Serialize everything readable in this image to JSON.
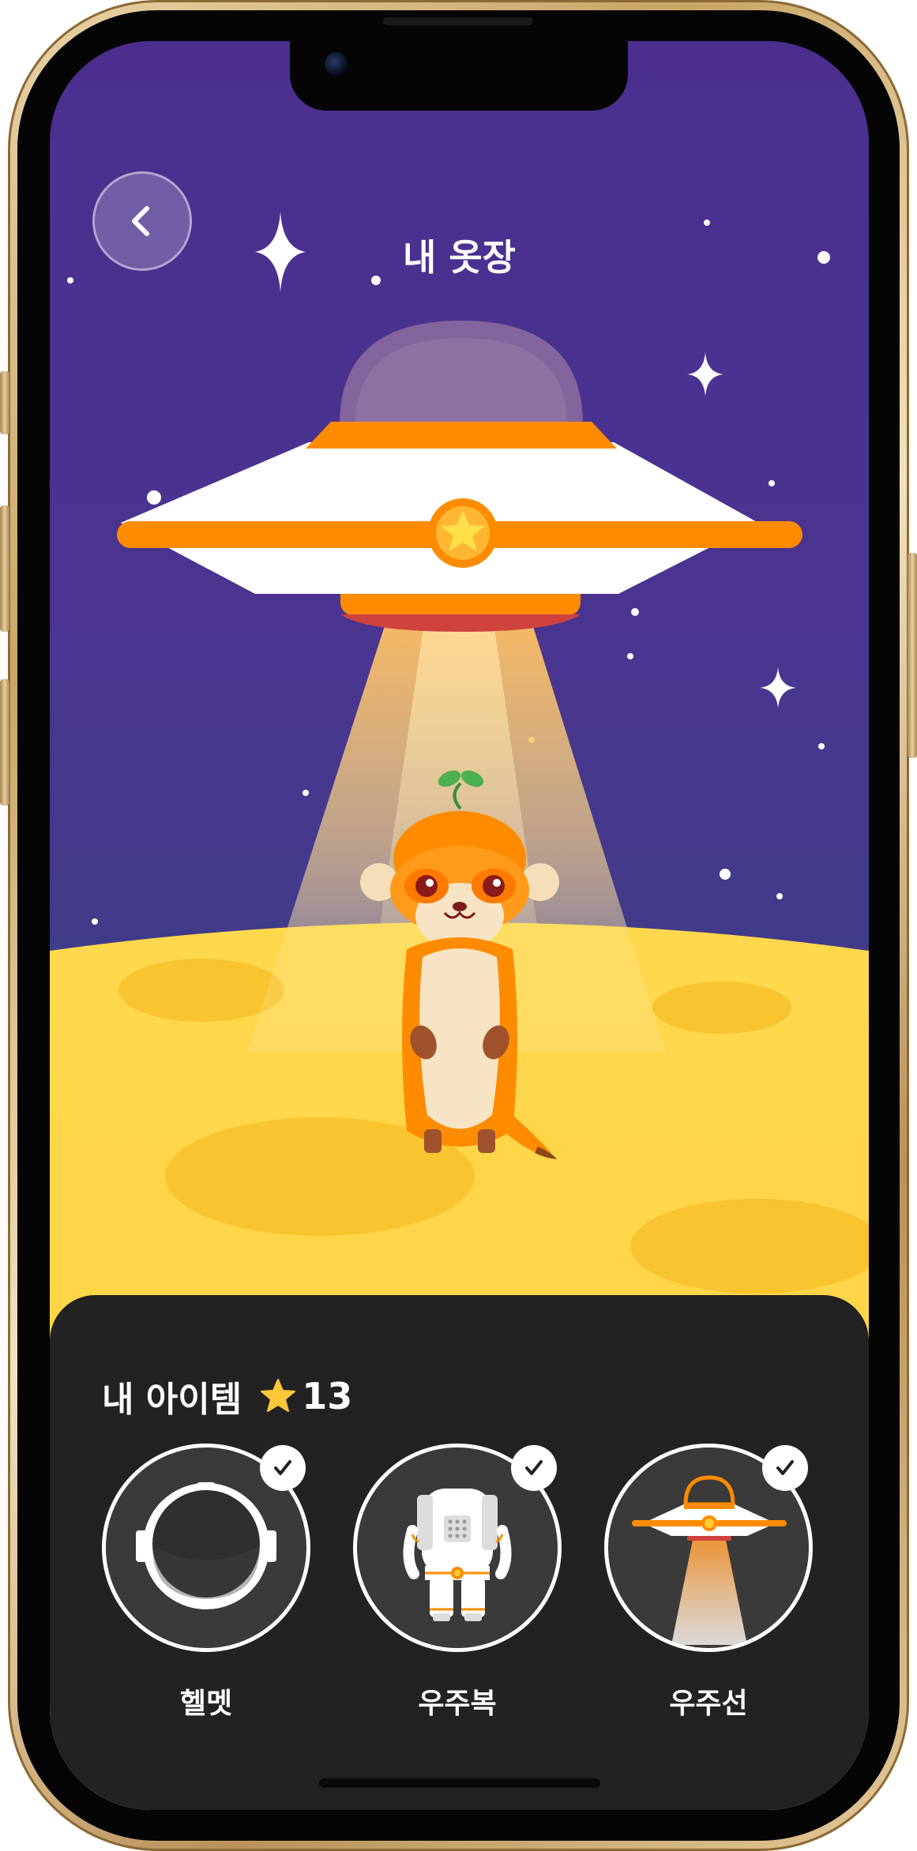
{
  "header": {
    "title": "내 옷장",
    "back_icon": "chevron-left-icon"
  },
  "scene": {
    "character": "meerkat",
    "vehicle": "ufo",
    "ground": "moon",
    "colors": {
      "sky_top": "#4a2f8f",
      "sky_bottom": "#2f3b7a",
      "moon": "#ffd54a",
      "ufo_accent": "#ff8c00"
    }
  },
  "items_panel": {
    "title": "내 아이템",
    "star_icon": "star-icon",
    "star_count": "13",
    "items": [
      {
        "label": "헬멧",
        "icon": "helmet-icon",
        "selected": true
      },
      {
        "label": "우주복",
        "icon": "spacesuit-icon",
        "selected": true
      },
      {
        "label": "우주선",
        "icon": "spaceship-icon",
        "selected": true
      }
    ]
  }
}
